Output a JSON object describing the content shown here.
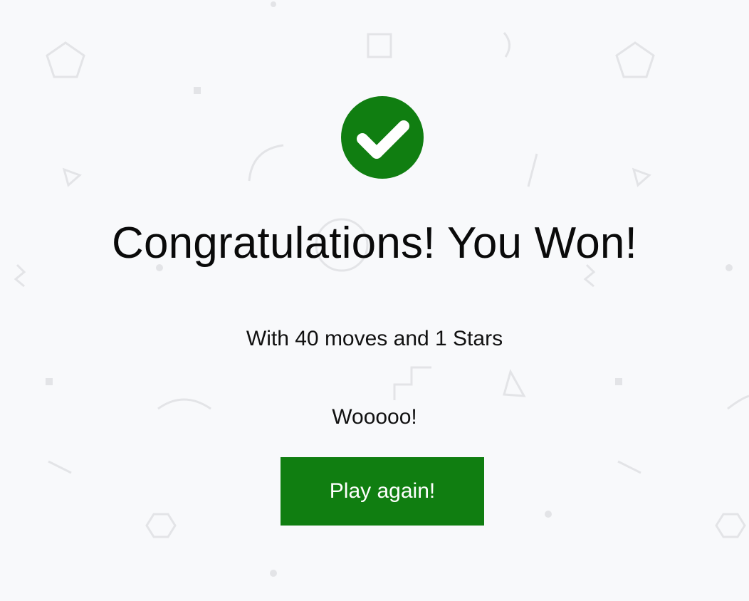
{
  "modal": {
    "title": "Congratulations! You Won!",
    "stats_text": "With 40 moves and 1 Stars",
    "cheer_text": "Wooooo!",
    "play_again_label": "Play again!"
  },
  "icons": {
    "success": "checkmark-icon"
  },
  "colors": {
    "accent_green": "#107e11",
    "background": "#f8f9fb",
    "pattern": "#e3e4e7",
    "text": "#0a0a0a"
  }
}
